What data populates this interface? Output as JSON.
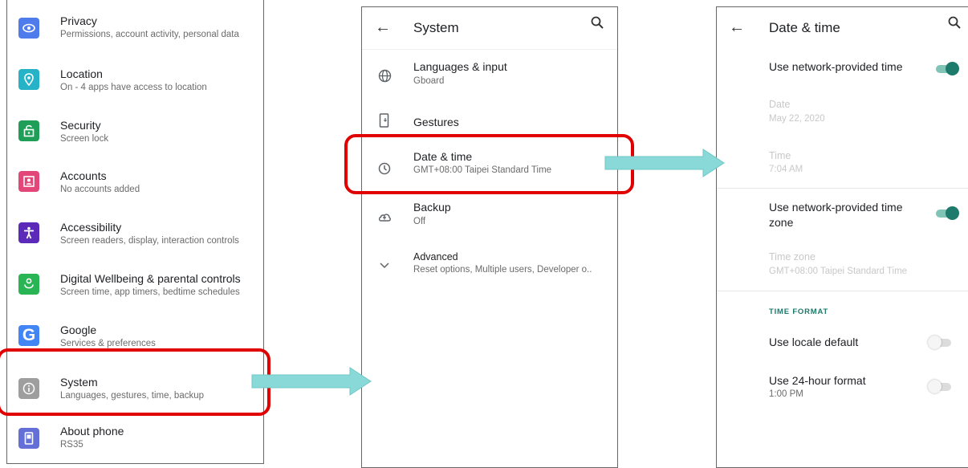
{
  "settings": {
    "items": [
      {
        "title": "Privacy",
        "subtitle": "Permissions, account activity, personal data",
        "icon": "privacy-icon",
        "color": "#4f7cec"
      },
      {
        "title": "Location",
        "subtitle": "On - 4 apps have access to location",
        "icon": "location-icon",
        "color": "#26b3c8"
      },
      {
        "title": "Security",
        "subtitle": "Screen lock",
        "icon": "lock-icon",
        "color": "#1e9e56"
      },
      {
        "title": "Accounts",
        "subtitle": "No accounts added",
        "icon": "account-icon",
        "color": "#e3477a"
      },
      {
        "title": "Accessibility",
        "subtitle": "Screen readers, display, interaction controls",
        "icon": "accessibility-icon",
        "color": "#5b2ab8"
      },
      {
        "title": "Digital Wellbeing & parental controls",
        "subtitle": "Screen time, app timers, bedtime schedules",
        "icon": "wellbeing-icon",
        "color": "#2ab554"
      },
      {
        "title": "Google",
        "subtitle": "Services & preferences",
        "icon": "google-icon",
        "color": "#4285f4"
      },
      {
        "title": "System",
        "subtitle": "Languages, gestures, time, backup",
        "icon": "info-icon",
        "color": "#9e9e9e"
      },
      {
        "title": "About phone",
        "subtitle": "RS35",
        "icon": "phone-icon",
        "color": "#6470d8"
      }
    ]
  },
  "system": {
    "title": "System",
    "items": [
      {
        "title": "Languages & input",
        "subtitle": "Gboard",
        "icon": "globe-icon"
      },
      {
        "title": "Gestures",
        "subtitle": "",
        "icon": "gestures-icon"
      },
      {
        "title": "Date & time",
        "subtitle": "GMT+08:00 Taipei Standard Time",
        "icon": "clock-icon"
      },
      {
        "title": "Backup",
        "subtitle": "Off",
        "icon": "backup-icon"
      },
      {
        "title": "Advanced",
        "subtitle": "Reset options, Multiple users, Developer o..",
        "icon": "chevron-down-icon"
      }
    ]
  },
  "datetime": {
    "title": "Date & time",
    "network_time": {
      "label": "Use network-provided time",
      "on": true
    },
    "date": {
      "label": "Date",
      "value": "May 22, 2020"
    },
    "time": {
      "label": "Time",
      "value": "7:04 AM"
    },
    "network_zone": {
      "label": "Use network-provided time zone",
      "on": true
    },
    "zone": {
      "label": "Time zone",
      "value": "GMT+08:00 Taipei Standard Time"
    },
    "section": "TIME FORMAT",
    "locale_default": {
      "label": "Use locale default",
      "on": false
    },
    "hour24": {
      "label": "Use 24-hour format",
      "value": "1:00 PM",
      "on": false
    }
  },
  "colors": {
    "highlight": "#e00000",
    "arrow": "#8ad9d9",
    "accent": "#1e7a6a"
  }
}
